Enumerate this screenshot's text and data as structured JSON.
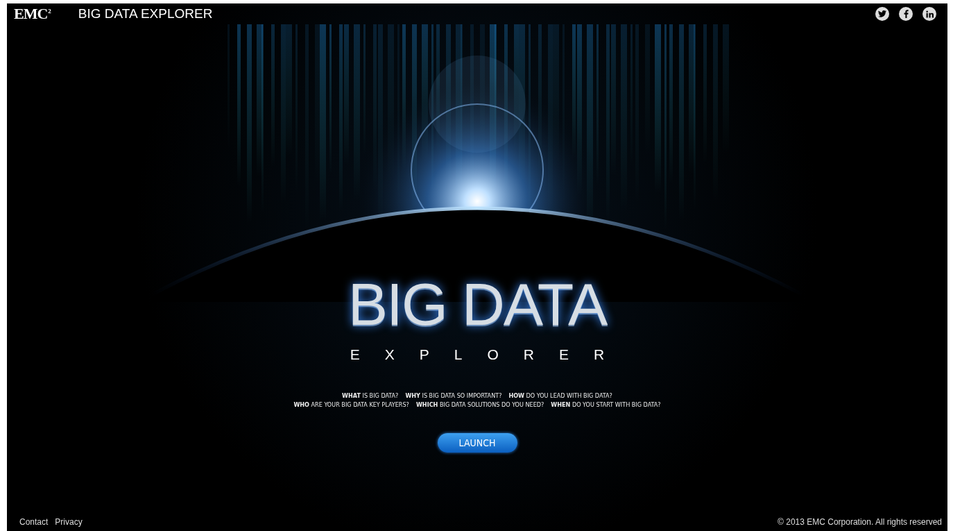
{
  "header": {
    "logo": "EMC",
    "logo_sup": "2",
    "title": "BIG DATA EXPLORER",
    "social": [
      {
        "kind": "twitter"
      },
      {
        "kind": "facebook"
      },
      {
        "kind": "linkedin"
      }
    ]
  },
  "hero": {
    "title": "BIG DATA",
    "subtitle": "EXPLORER"
  },
  "questions": [
    [
      "**WHAT** IS BIG DATA?",
      "**WHY** IS BIG DATA SO IMPORTANT?",
      "**HOW** DO YOU LEAD WITH BIG DATA?"
    ],
    [
      "**WHO** ARE YOUR BIG DATA KEY PLAYERS?",
      "**WHICH** BIG DATA SOLUTIONS DO YOU NEED?",
      "**WHEN** DO YOU START WITH BIG DATA?"
    ]
  ],
  "launch_button": "LAUNCH",
  "footer": {
    "links": [
      "Contact",
      "Privacy"
    ],
    "copyright": "© 2013 EMC Corporation. All rights reserved"
  }
}
